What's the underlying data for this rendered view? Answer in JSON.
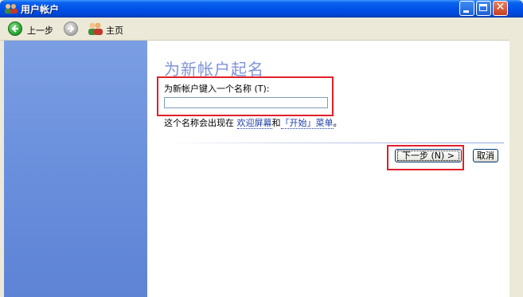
{
  "window": {
    "title": "用户帐户",
    "app_icon": "users-icon",
    "controls": [
      "minimize",
      "maximize",
      "close"
    ]
  },
  "toolbar": {
    "back_label": "上一步",
    "back_icon": "back-arrow-icon",
    "forward_icon": "forward-arrow-icon",
    "home_label": "主页",
    "home_icon": "users-icon"
  },
  "main": {
    "title": "为新帐户起名",
    "field_label": "为新帐户键入一个名称 (T):",
    "name_input_value": "",
    "hint_prefix": "这个名称会出现在",
    "hint_link1": "欢迎屏幕",
    "hint_mid": "和",
    "hint_link2": "「开始」菜单",
    "hint_suffix": "。"
  },
  "buttons": {
    "next_label": "下一步 (N) >",
    "cancel_label": "取消"
  },
  "colors": {
    "title_bar": "#0050E8",
    "left_pane": "#6A8FDC",
    "page_title": "#7F93D9",
    "link": "#1E3FA6",
    "highlight": "#E0202A"
  }
}
